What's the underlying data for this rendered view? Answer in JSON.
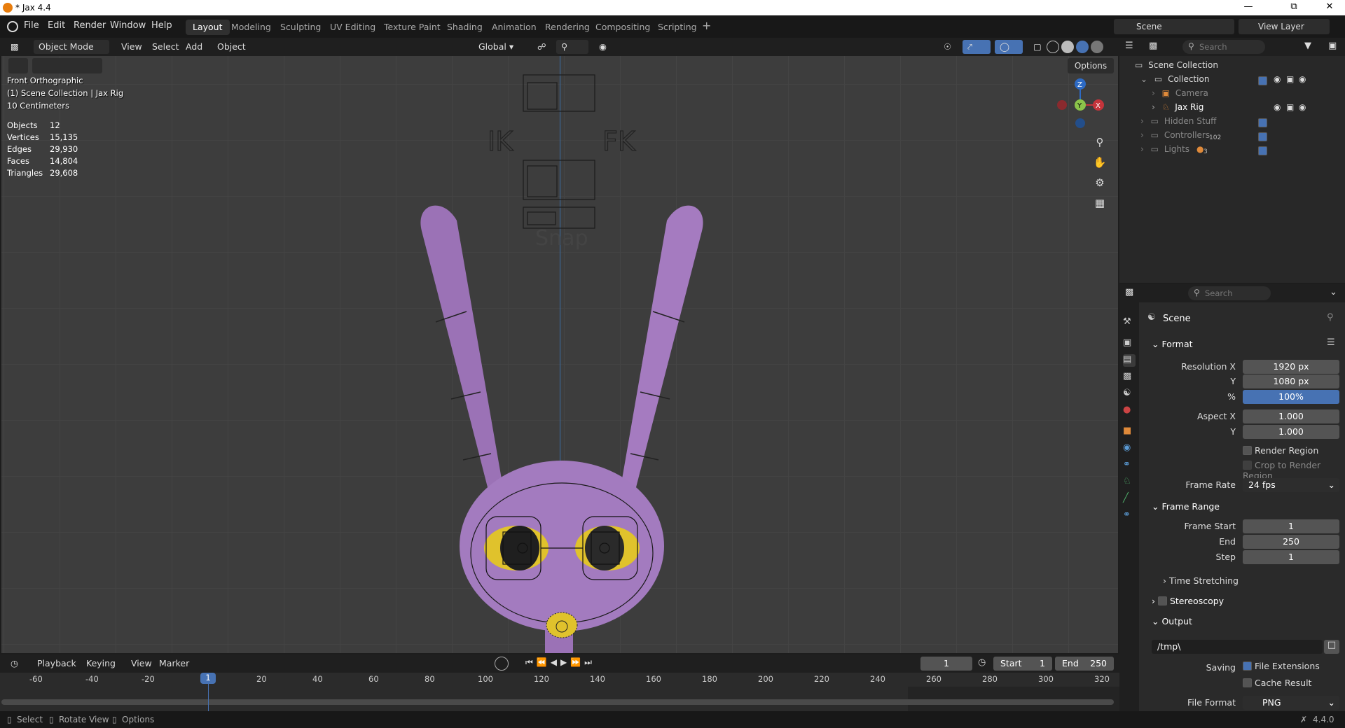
{
  "window": {
    "title": "* Jax 4.4"
  },
  "menus": [
    "File",
    "Edit",
    "Render",
    "Window",
    "Help"
  ],
  "workspaces": [
    "Layout",
    "Modeling",
    "Sculpting",
    "UV Editing",
    "Texture Paint",
    "Shading",
    "Animation",
    "Rendering",
    "Compositing",
    "Scripting"
  ],
  "scene_selector": {
    "label": "Scene",
    "view_layer": "View Layer"
  },
  "viewport_header": {
    "mode": "Object Mode",
    "view": "View",
    "select": "Select",
    "add": "Add",
    "object": "Object",
    "orientation": "Global",
    "options": "Options"
  },
  "overlay": {
    "view_name": "Front Orthographic",
    "collection_info": "(1) Scene Collection | Jax Rig",
    "scale": "10 Centimeters",
    "stats": [
      {
        "label": "Objects",
        "value": "12"
      },
      {
        "label": "Vertices",
        "value": "15,135"
      },
      {
        "label": "Edges",
        "value": "29,930"
      },
      {
        "label": "Faces",
        "value": "14,804"
      },
      {
        "label": "Triangles",
        "value": "29,608"
      }
    ]
  },
  "rig_labels": {
    "ik": "IK",
    "fk": "FK",
    "snap": "Snap"
  },
  "gizmo": {
    "z": "Z",
    "y": "Y",
    "x": "X"
  },
  "outliner": {
    "search_placeholder": "Search",
    "root": "Scene Collection",
    "items": [
      {
        "label": "Collection"
      },
      {
        "label": "Camera"
      },
      {
        "label": "Jax Rig"
      },
      {
        "label": "Hidden Stuff"
      },
      {
        "label": "Controllers",
        "count": "102"
      },
      {
        "label": "Lights",
        "count": "3"
      }
    ]
  },
  "properties": {
    "search_placeholder": "Search",
    "title": "Scene",
    "format": {
      "header": "Format",
      "resolution_x_label": "Resolution X",
      "resolution_x": "1920 px",
      "y_label": "Y",
      "resolution_y": "1080 px",
      "percent_label": "%",
      "percent": "100%",
      "aspect_x_label": "Aspect X",
      "aspect_x": "1.000",
      "aspect_y_label": "Y",
      "aspect_y": "1.000",
      "render_region": "Render Region",
      "crop_region": "Crop to Render Region",
      "frame_rate_label": "Frame Rate",
      "frame_rate": "24 fps"
    },
    "frame_range": {
      "header": "Frame Range",
      "start_label": "Frame Start",
      "start": "1",
      "end_label": "End",
      "end": "250",
      "step_label": "Step",
      "step": "1",
      "time_stretching": "Time Stretching"
    },
    "stereoscopy": "Stereoscopy",
    "output": {
      "header": "Output",
      "path": "/tmp\\",
      "saving_label": "Saving",
      "file_extensions": "File Extensions",
      "cache_result": "Cache Result",
      "file_format_label": "File Format",
      "file_format": "PNG"
    }
  },
  "timeline": {
    "playback": "Playback",
    "keying": "Keying",
    "view": "View",
    "marker": "Marker",
    "current_frame": "1",
    "start_label": "Start",
    "start": "1",
    "end_label": "End",
    "end": "250",
    "ticks": [
      "-60",
      "-40",
      "-20",
      "1",
      "20",
      "40",
      "60",
      "80",
      "100",
      "120",
      "140",
      "160",
      "180",
      "200",
      "220",
      "240",
      "260",
      "280",
      "300",
      "320"
    ]
  },
  "statusbar": {
    "select": "Select",
    "rotate": "Rotate View",
    "options": "Options",
    "version": "4.4.0"
  }
}
